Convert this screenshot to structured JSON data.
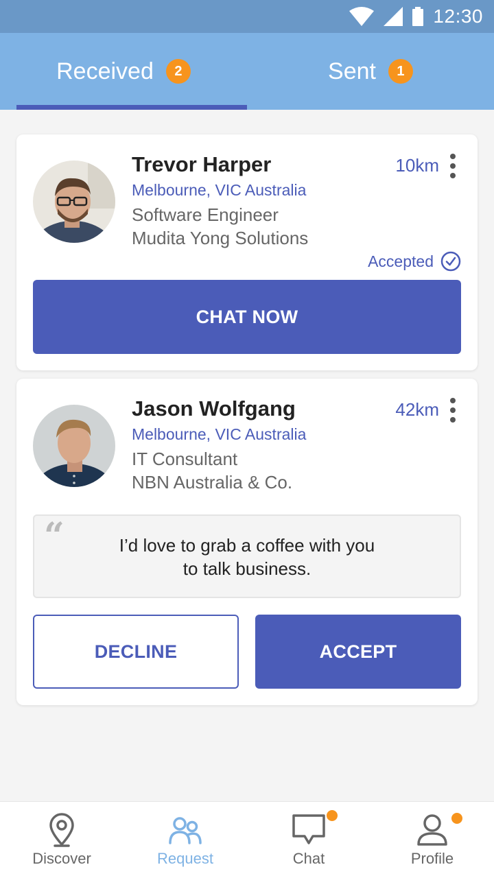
{
  "status_bar": {
    "time": "12:30"
  },
  "tabs": [
    {
      "label": "Received",
      "badge": "2",
      "active": true
    },
    {
      "label": "Sent",
      "badge": "1",
      "active": false
    }
  ],
  "requests": [
    {
      "name": "Trevor Harper",
      "location": "Melbourne, VIC Australia",
      "title": "Software Engineer",
      "company": "Mudita Yong Solutions",
      "distance": "10km",
      "status": "Accepted",
      "action_label": "CHAT NOW"
    },
    {
      "name": "Jason Wolfgang",
      "location": "Melbourne, VIC Australia",
      "title": "IT Consultant",
      "company": "NBN Australia & Co.",
      "distance": "42km",
      "message_line1": "I’d love to grab a coffee with you",
      "message_line2": "to talk business.",
      "decline_label": "DECLINE",
      "accept_label": "ACCEPT"
    }
  ],
  "bottom_nav": [
    {
      "label": "Discover",
      "icon": "map-pin-icon"
    },
    {
      "label": "Request",
      "icon": "people-icon",
      "active": true
    },
    {
      "label": "Chat",
      "icon": "chat-bubble-icon",
      "notification": true
    },
    {
      "label": "Profile",
      "icon": "user-icon",
      "notification": true
    }
  ],
  "colors": {
    "status_bar": "#6a98c7",
    "tab_bar": "#7eb2e4",
    "primary": "#4b5cb8",
    "badge": "#f7941d",
    "background": "#f4f4f4"
  }
}
